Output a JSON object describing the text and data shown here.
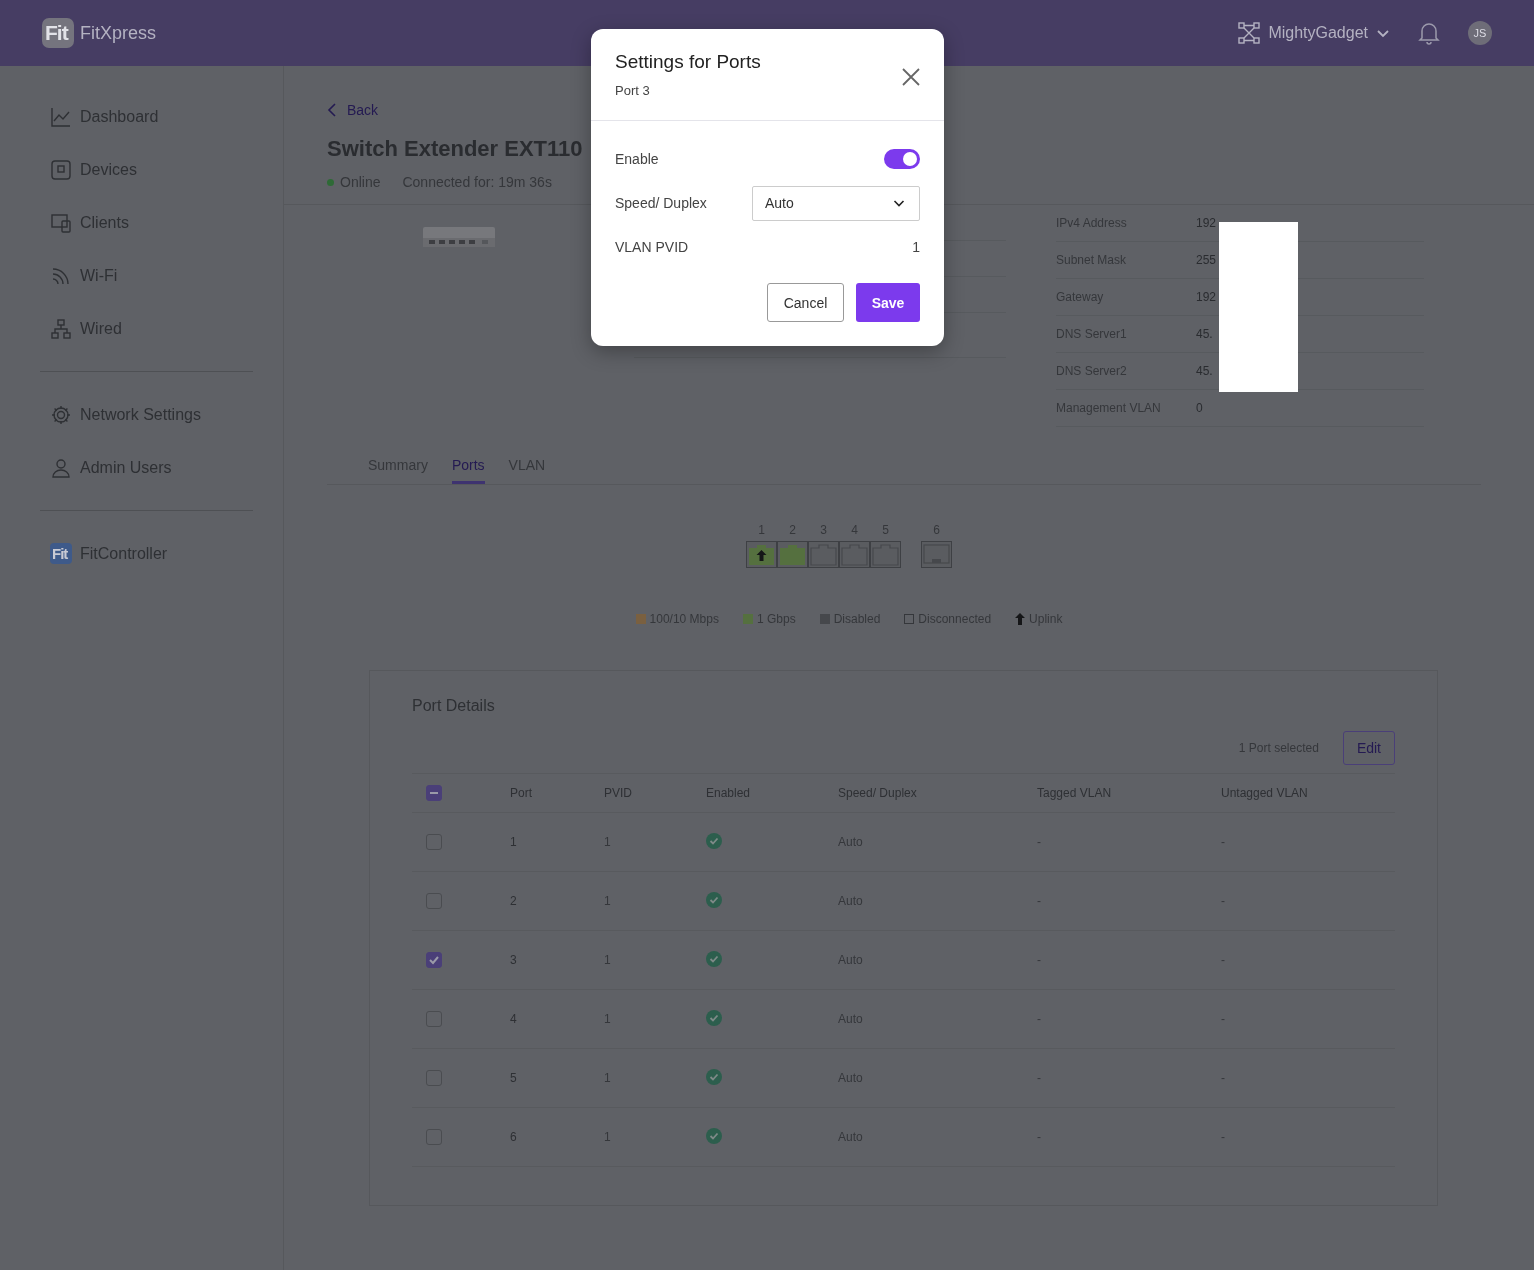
{
  "app_bar": {
    "logo_mark": "Fit",
    "app_name": "FitXpress",
    "site": "MightyGadget",
    "avatar": "JS"
  },
  "sidebar": {
    "groups": [
      [
        {
          "label": "Dashboard"
        },
        {
          "label": "Devices"
        },
        {
          "label": "Clients"
        },
        {
          "label": "Wi-Fi"
        },
        {
          "label": "Wired"
        }
      ],
      [
        {
          "label": "Network Settings"
        },
        {
          "label": "Admin Users"
        }
      ],
      [
        {
          "label": "FitController",
          "logo_mark": "Fit"
        }
      ]
    ]
  },
  "page": {
    "back": "Back",
    "title": "Switch Extender EXT110",
    "status": "Online",
    "connected": "Connected for: 19m 36s"
  },
  "info": {
    "right": [
      {
        "label": "IPv4 Address",
        "value": "192"
      },
      {
        "label": "Subnet Mask",
        "value": "255"
      },
      {
        "label": "Gateway",
        "value": "192"
      },
      {
        "label": "DNS Server1",
        "value": "45."
      },
      {
        "label": "DNS Server2",
        "value": "45."
      },
      {
        "label": "Management VLAN",
        "value": "0"
      }
    ]
  },
  "tabs": [
    {
      "label": "Summary",
      "selected": false
    },
    {
      "label": "Ports",
      "selected": true
    },
    {
      "label": "VLAN",
      "selected": false
    }
  ],
  "ports": [
    {
      "number": "1",
      "kind": "rj45",
      "connected": true,
      "color": "#55703f",
      "uplink": true
    },
    {
      "number": "2",
      "kind": "rj45",
      "connected": true,
      "color": "#55703f",
      "uplink": false
    },
    {
      "number": "3",
      "kind": "rj45",
      "connected": false,
      "uplink": false
    },
    {
      "number": "4",
      "kind": "rj45",
      "connected": false,
      "uplink": false
    },
    {
      "number": "5",
      "kind": "rj45",
      "connected": false,
      "uplink": false
    },
    {
      "number": "6",
      "kind": "sfp",
      "connected": false,
      "uplink": false
    }
  ],
  "legend": [
    {
      "kind": "swatch",
      "label": "100/10 Mbps",
      "color": "#7a6040"
    },
    {
      "kind": "swatch",
      "label": "1 Gbps",
      "color": "#55703f"
    },
    {
      "kind": "swatch",
      "label": "Disabled",
      "color": "#46484c"
    },
    {
      "kind": "outline",
      "label": "Disconnected"
    },
    {
      "kind": "arrow",
      "label": "Uplink"
    }
  ],
  "port_details": {
    "title": "Port Details",
    "selection": "1 Port selected",
    "edit": "Edit",
    "header_indeterminate": true,
    "columns": [
      "Port",
      "PVID",
      "Enabled",
      "Speed/ Duplex",
      "Tagged VLAN",
      "Untagged VLAN"
    ],
    "rows": [
      {
        "checked": false,
        "port": "1",
        "pvid": "1",
        "enabled": true,
        "speed": "Auto",
        "tagged": "-",
        "untagged": "-"
      },
      {
        "checked": false,
        "port": "2",
        "pvid": "1",
        "enabled": true,
        "speed": "Auto",
        "tagged": "-",
        "untagged": "-"
      },
      {
        "checked": true,
        "port": "3",
        "pvid": "1",
        "enabled": true,
        "speed": "Auto",
        "tagged": "-",
        "untagged": "-"
      },
      {
        "checked": false,
        "port": "4",
        "pvid": "1",
        "enabled": true,
        "speed": "Auto",
        "tagged": "-",
        "untagged": "-"
      },
      {
        "checked": false,
        "port": "5",
        "pvid": "1",
        "enabled": true,
        "speed": "Auto",
        "tagged": "-",
        "untagged": "-"
      },
      {
        "checked": false,
        "port": "6",
        "pvid": "1",
        "enabled": true,
        "speed": "Auto",
        "tagged": "-",
        "untagged": "-"
      }
    ]
  },
  "dialog": {
    "title": "Settings for Ports",
    "subtitle": "Port 3",
    "enable_label": "Enable",
    "enable_on": true,
    "speed_label": "Speed/ Duplex",
    "speed_value": "Auto",
    "pvid_label": "VLAN PVID",
    "pvid_value": "1",
    "cancel": "Cancel",
    "save": "Save"
  }
}
